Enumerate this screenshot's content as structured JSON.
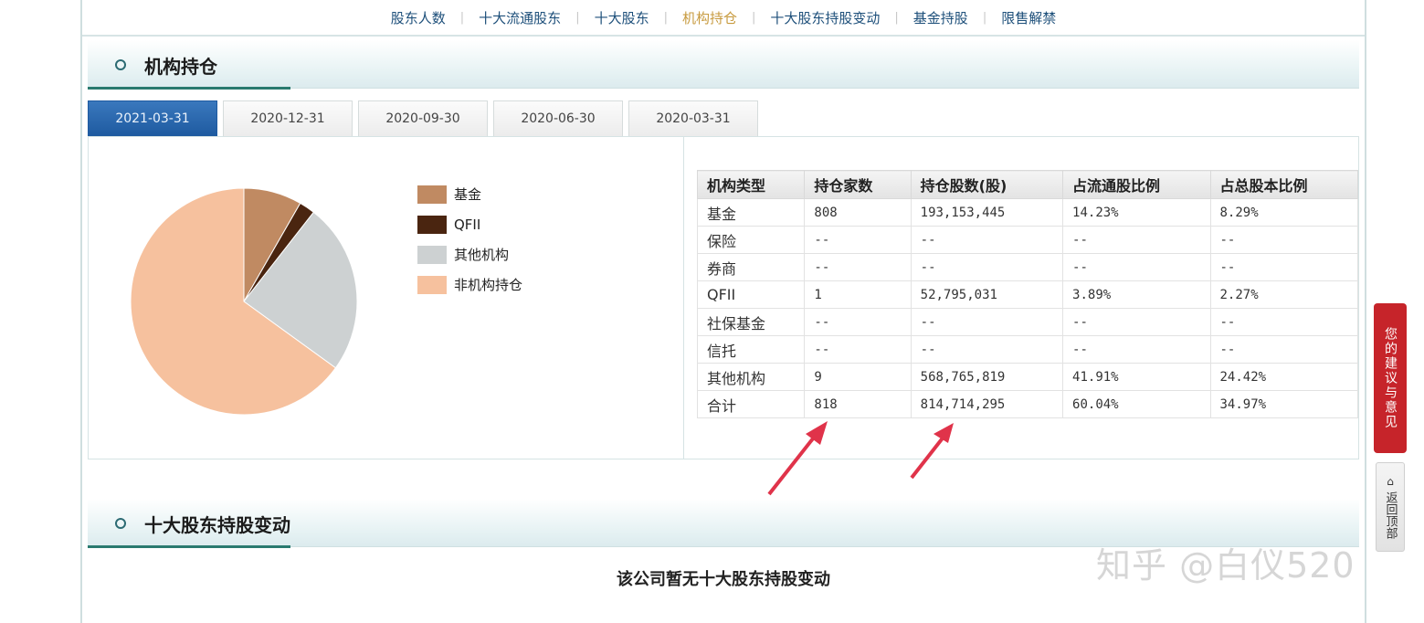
{
  "nav": {
    "items": [
      {
        "label": "股东人数",
        "active": false
      },
      {
        "label": "十大流通股东",
        "active": false
      },
      {
        "label": "十大股东",
        "active": false
      },
      {
        "label": "机构持仓",
        "active": true
      },
      {
        "label": "十大股东持股变动",
        "active": false
      },
      {
        "label": "基金持股",
        "active": false
      },
      {
        "label": "限售解禁",
        "active": false
      }
    ]
  },
  "section1": {
    "title": "机构持仓",
    "tabs": [
      "2021-03-31",
      "2020-12-31",
      "2020-09-30",
      "2020-06-30",
      "2020-03-31"
    ],
    "active_tab": 0
  },
  "pie": {
    "legend": [
      {
        "label": "基金",
        "color": "#c08a62"
      },
      {
        "label": "QFII",
        "color": "#4a2510"
      },
      {
        "label": "其他机构",
        "color": "#cdd1d2"
      },
      {
        "label": "非机构持仓",
        "color": "#f6c19e"
      }
    ]
  },
  "chart_data": {
    "type": "pie",
    "slices": [
      {
        "label": "基金",
        "value": 8.29,
        "color": "#c08a62"
      },
      {
        "label": "QFII",
        "value": 2.27,
        "color": "#4a2510"
      },
      {
        "label": "其他机构",
        "value": 24.42,
        "color": "#cdd1d2"
      },
      {
        "label": "非机构持仓",
        "value": 65.02,
        "color": "#f6c19e"
      }
    ]
  },
  "table": {
    "headers": [
      "机构类型",
      "持仓家数",
      "持仓股数(股)",
      "占流通股比例",
      "占总股本比例"
    ],
    "rows": [
      [
        "基金",
        "808",
        "193,153,445",
        "14.23%",
        "8.29%"
      ],
      [
        "保险",
        "--",
        "--",
        "--",
        "--"
      ],
      [
        "券商",
        "--",
        "--",
        "--",
        "--"
      ],
      [
        "QFII",
        "1",
        "52,795,031",
        "3.89%",
        "2.27%"
      ],
      [
        "社保基金",
        "--",
        "--",
        "--",
        "--"
      ],
      [
        "信托",
        "--",
        "--",
        "--",
        "--"
      ],
      [
        "其他机构",
        "9",
        "568,765,819",
        "41.91%",
        "24.42%"
      ],
      [
        "合计",
        "818",
        "814,714,295",
        "60.04%",
        "34.97%"
      ]
    ]
  },
  "section2": {
    "title": "十大股东持股变动",
    "empty_message": "该公司暂无十大股东持股变动"
  },
  "side": {
    "feedback_label": "您的建议与意见",
    "back_top_label": "返回顶部",
    "back_top_icon": "home-icon"
  },
  "watermark": "知乎 @白仪520",
  "colors": {
    "accent_blue": "#1e5aa0",
    "nav_active": "#c79a3e",
    "arrow_red": "#e0334a"
  }
}
